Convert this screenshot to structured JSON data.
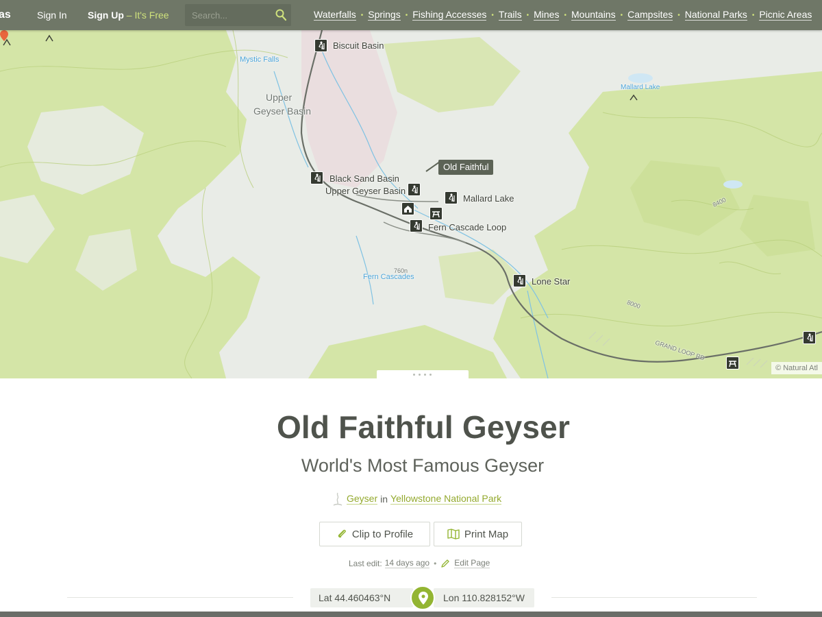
{
  "nav": {
    "brand": "as",
    "signin": "Sign In",
    "signup_main": "Sign Up",
    "signup_free": " – It's Free",
    "search_placeholder": "Search...",
    "categories": [
      "Waterfalls",
      "Springs",
      "Fishing Accesses",
      "Trails",
      "Mines",
      "Mountains",
      "Campsites",
      "National Parks",
      "Picnic Areas"
    ]
  },
  "map": {
    "labels": {
      "biscuit_basin": "Biscuit Basin",
      "mystic_falls": "Mystic Falls",
      "upper_geyser_basin_area": "Upper\nGeyser Basin",
      "mallard_lake_lake": "Mallard Lake",
      "black_sand_basin": "Black Sand Basin",
      "upper_geyser_basin": "Upper Geyser Basin",
      "old_faithful": "Old Faithful",
      "mallard_lake_trail": "Mallard Lake",
      "fern_cascade_loop": "Fern Cascade Loop",
      "fern_cascades": "Fern Cascades",
      "lone_star": "Lone Star",
      "grand_loop_rd": "GRAND LOOP RD",
      "elev_8400": "8400",
      "elev_8000": "8000",
      "elev_7600": "760n"
    },
    "attribution": "© Natural Atl"
  },
  "page": {
    "title": "Old Faithful Geyser",
    "subtitle": "World's Most Famous Geyser",
    "type_link": "Geyser",
    "in_word": "in",
    "park_link": "Yellowstone National Park",
    "clip_button": "Clip to Profile",
    "print_button": "Print Map",
    "last_edit_label": "Last edit:",
    "last_edit_value": "14 days ago",
    "separator": "•",
    "edit_page": "Edit Page",
    "lat_label": "Lat",
    "lat_value": "44.460463°N",
    "lon_label": "Lon",
    "lon_value": "110.828152°W"
  },
  "colors": {
    "nav_bg": "#6f7767",
    "accent_green": "#93b532",
    "map_green": "#cfe39a",
    "water_blue": "#4aa3d7"
  },
  "icons": [
    "search-icon",
    "hiker-icon",
    "picnic-table-icon",
    "lodge-icon",
    "map-pin-icon",
    "paperclip-icon",
    "map-icon",
    "pencil-icon",
    "location-pin-icon",
    "geyser-icon"
  ]
}
